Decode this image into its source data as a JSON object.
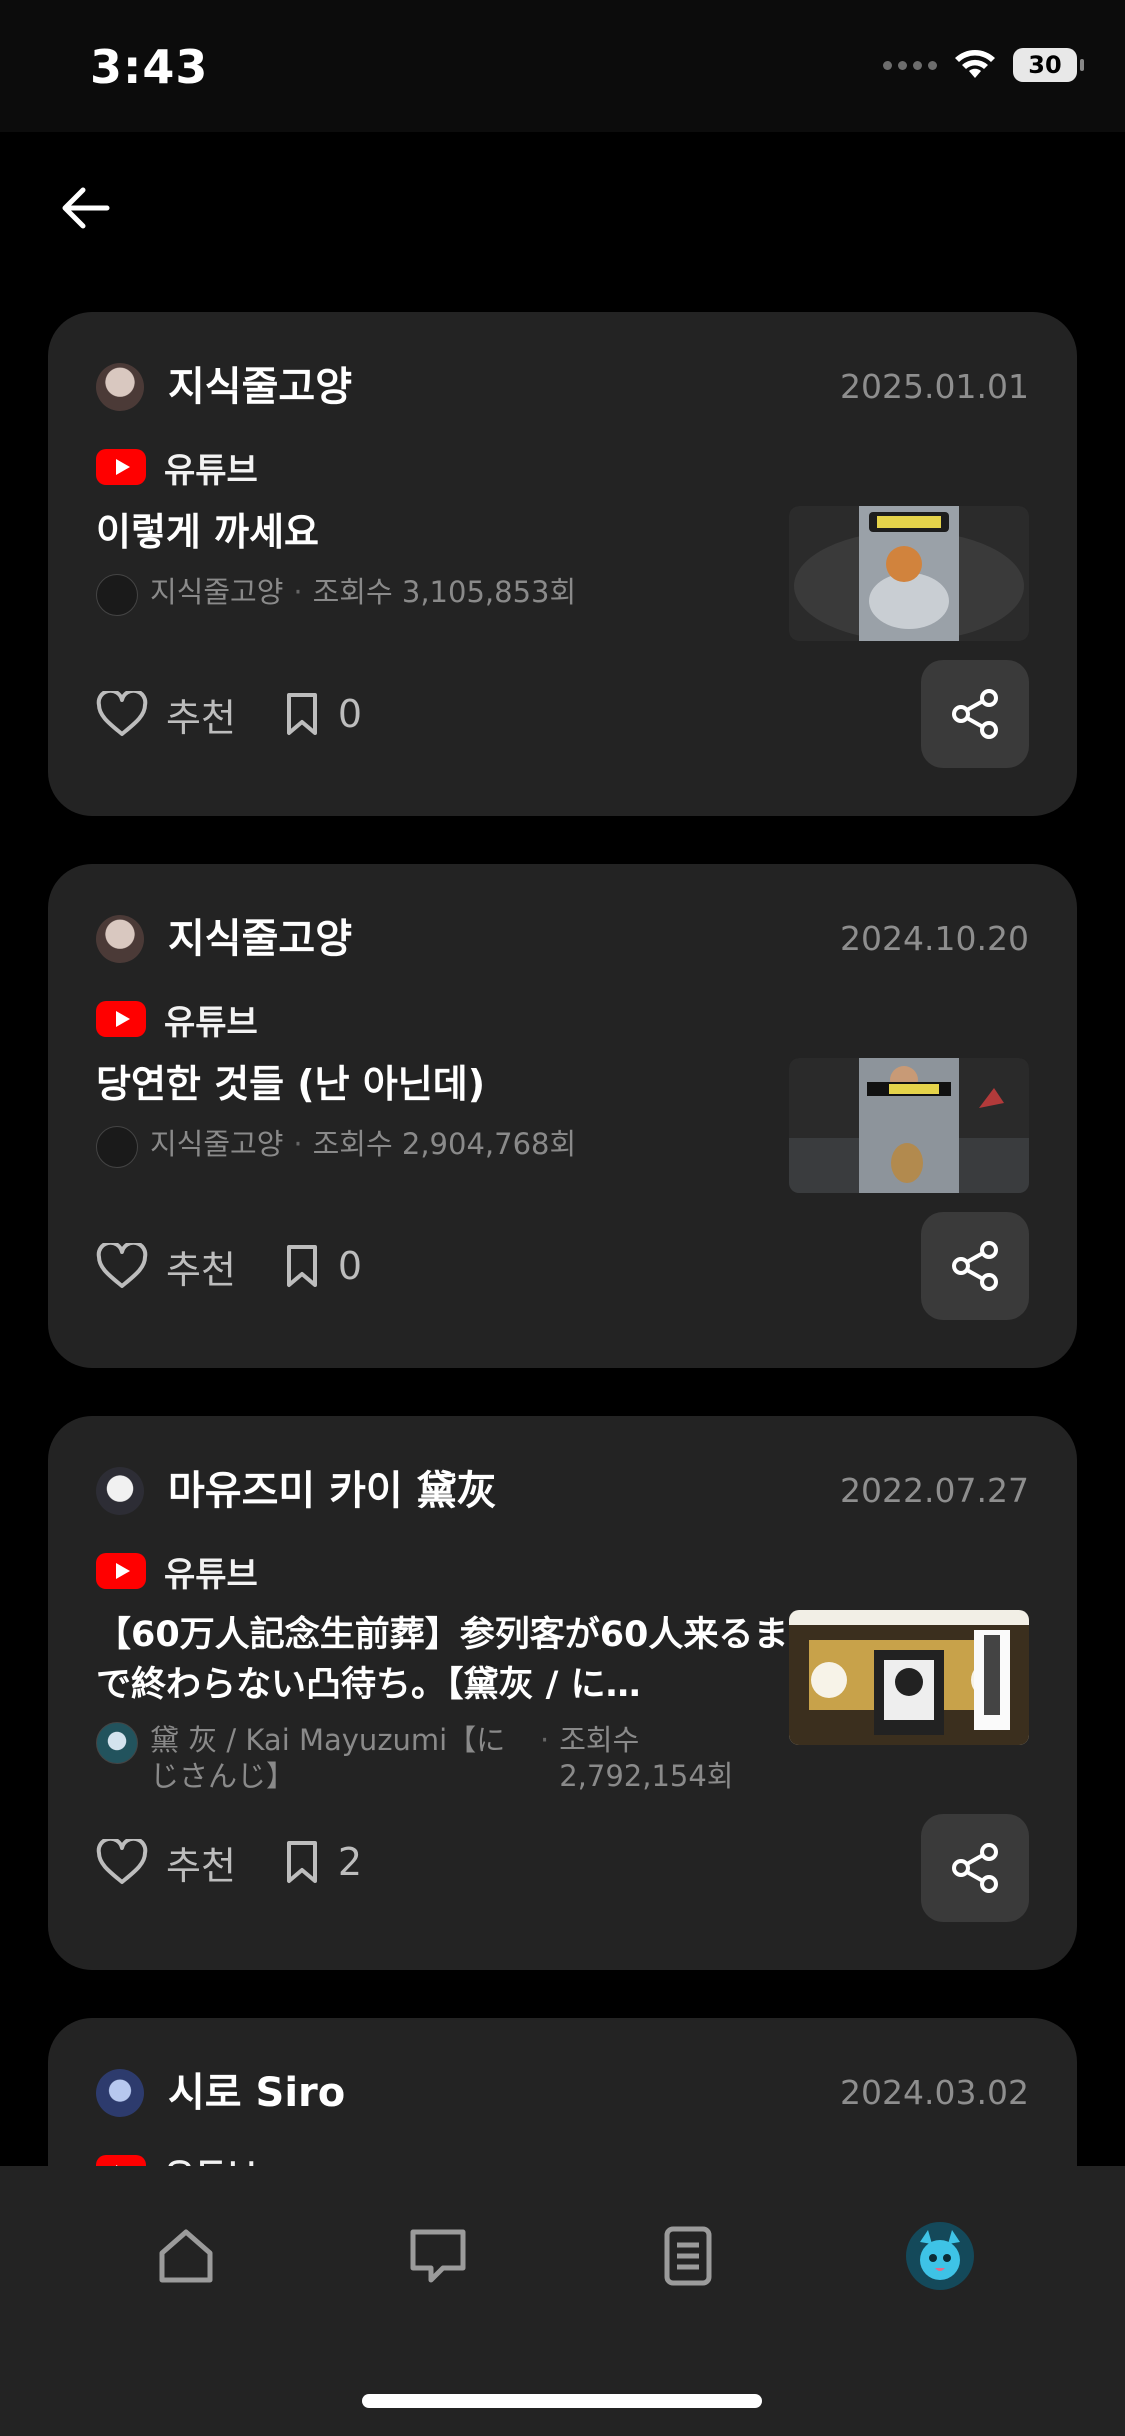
{
  "status": {
    "time": "3:43",
    "battery": "30"
  },
  "cards": [
    {
      "author": "지식줄고양",
      "date": "2025.01.01",
      "source": "유튜브",
      "title": "이렇게 까세요",
      "channel": "지식줄고양",
      "views": "조회수 3,105,853회",
      "like_label": "추천",
      "bookmark_count": "0"
    },
    {
      "author": "지식줄고양",
      "date": "2024.10.20",
      "source": "유튜브",
      "title": "당연한 것들 (난 아닌데)",
      "channel": "지식줄고양",
      "views": "조회수 2,904,768회",
      "like_label": "추천",
      "bookmark_count": "0"
    },
    {
      "author": "마유즈미 카이 黛灰",
      "date": "2022.07.27",
      "source": "유튜브",
      "title": "【60万人記念生前葬】参列客が60人来るまで終わらない凸待ち。【黛灰 / に…",
      "channel": "黛 灰 / Kai Mayuzumi【にじさんじ】",
      "views": "조회수 2,792,154회",
      "like_label": "추천",
      "bookmark_count": "2"
    },
    {
      "author": "시로 Siro",
      "date": "2024.03.02",
      "source": "유튜브"
    }
  ],
  "colors": {
    "card_bg": "#232323",
    "youtube_red": "#ff0000",
    "muted_text": "#8e8e8e"
  },
  "icons": [
    "back-arrow-icon",
    "heart-icon",
    "bookmark-icon",
    "share-icon",
    "home-icon",
    "chat-icon",
    "document-icon",
    "profile-icon"
  ]
}
